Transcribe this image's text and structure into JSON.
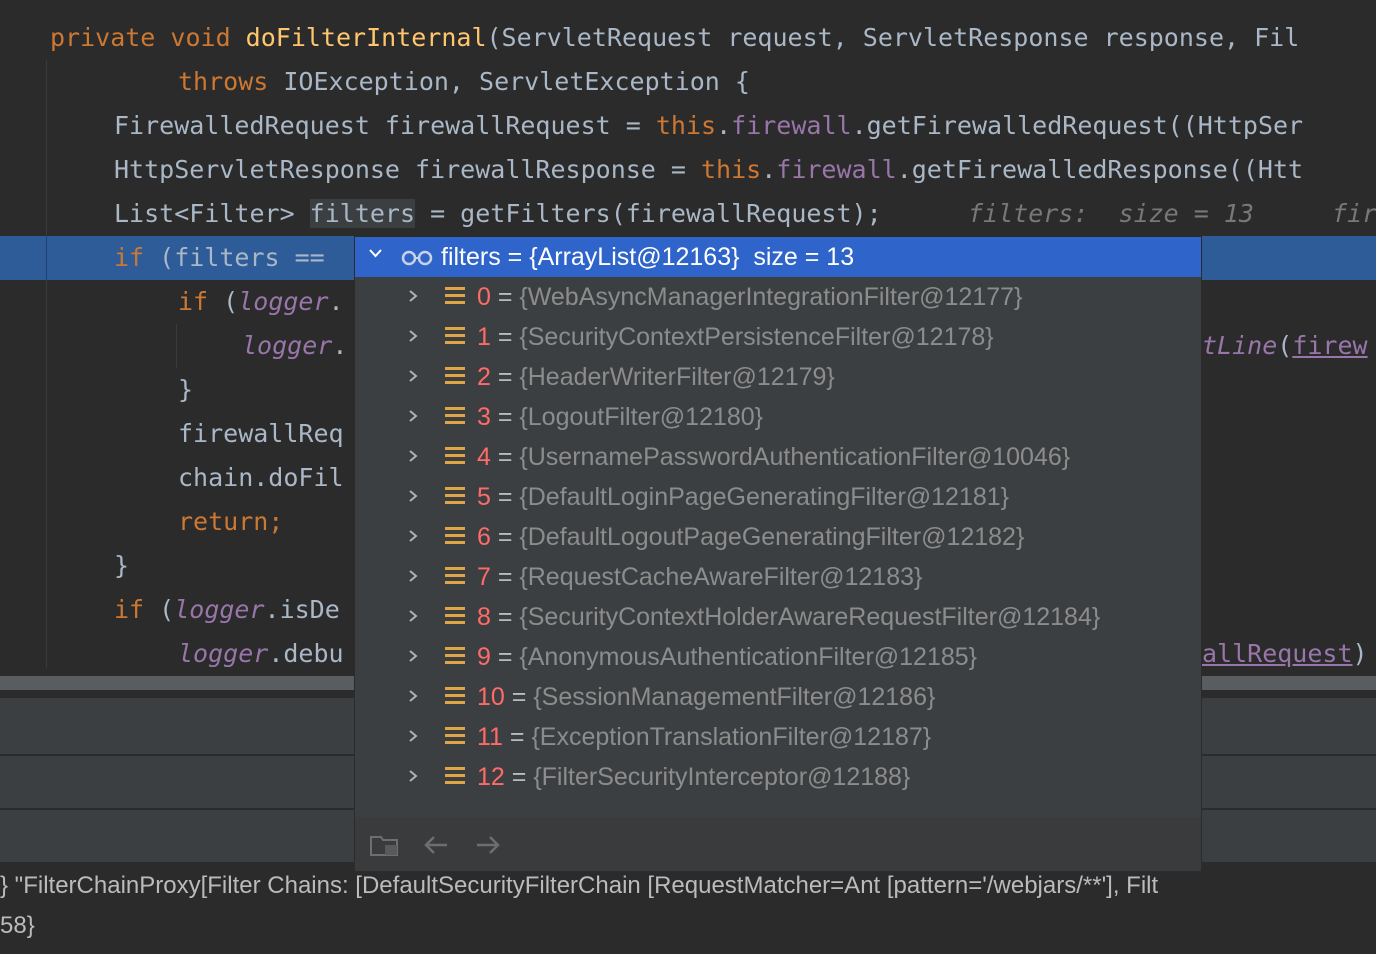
{
  "editor": {
    "line1": {
      "kw": "private void ",
      "fn": "doFilterInternal",
      "rest": "(ServletRequest request, ServletResponse response, Fil"
    },
    "line2": {
      "kw": "throws ",
      "rest": "IOException, ServletException {"
    },
    "line3": {
      "a": "FirewalledRequest firewallRequest = ",
      "kw": "this",
      "dot": ".",
      "field": "firewall",
      "rest": ".getFirewalledRequest((HttpSer"
    },
    "line4": {
      "a": "HttpServletResponse firewallResponse = ",
      "kw": "this",
      "dot": ".",
      "field": "firewall",
      "rest": ".getFirewalledResponse((Htt"
    },
    "line5": {
      "a": "List<Filter> ",
      "word": "filters",
      "b": " = getFilters(firewallRequest);",
      "semi": "",
      "hint1": "filters:  size = 13",
      "hint2": "fir"
    },
    "line6": {
      "kw": "if ",
      "rest": "(filters == "
    },
    "line7": {
      "kw": "if ",
      "a": "(",
      "it": "logger",
      "b": "."
    },
    "line8": {
      "it": "logger",
      "b": ".",
      "right_it": "tLine",
      "right_p": "(",
      "right_f": "firew"
    },
    "line9": {
      "text": "}"
    },
    "line10": {
      "text": "firewallReq"
    },
    "line11": {
      "text": "chain.doFil"
    },
    "line12": {
      "kw": "return;"
    },
    "line13": {
      "text": "}"
    },
    "line14": {
      "kw": "if ",
      "a": "(",
      "it": "logger",
      "b": ".isDe"
    },
    "line15": {
      "it": "logger",
      "b": ".debu",
      "right_f": "allRequest",
      "right_p": ")"
    }
  },
  "popup": {
    "header": "filters = {ArrayList@12163}  size = 13",
    "items": [
      {
        "index": "0",
        "value": "{WebAsyncManagerIntegrationFilter@12177}"
      },
      {
        "index": "1",
        "value": "{SecurityContextPersistenceFilter@12178}"
      },
      {
        "index": "2",
        "value": "{HeaderWriterFilter@12179}"
      },
      {
        "index": "3",
        "value": "{LogoutFilter@12180}"
      },
      {
        "index": "4",
        "value": "{UsernamePasswordAuthenticationFilter@10046}"
      },
      {
        "index": "5",
        "value": "{DefaultLoginPageGeneratingFilter@12181}"
      },
      {
        "index": "6",
        "value": "{DefaultLogoutPageGeneratingFilter@12182}"
      },
      {
        "index": "7",
        "value": "{RequestCacheAwareFilter@12183}"
      },
      {
        "index": "8",
        "value": "{SecurityContextHolderAwareRequestFilter@12184}"
      },
      {
        "index": "9",
        "value": "{AnonymousAuthenticationFilter@12185}"
      },
      {
        "index": "10",
        "value": "{SessionManagementFilter@12186}"
      },
      {
        "index": "11",
        "value": "{ExceptionTranslationFilter@12187}"
      },
      {
        "index": "12",
        "value": "{FilterSecurityInterceptor@12188}"
      }
    ],
    "footer_icons": [
      "open-in-tree-icon",
      "back-arrow-icon",
      "forward-arrow-icon"
    ]
  },
  "console": {
    "line1": "} \"FilterChainProxy[Filter Chains: [DefaultSecurityFilterChain [RequestMatcher=Ant [pattern='/webjars/**'], Filt",
    "line2": "58}"
  },
  "colors": {
    "keyword": "#cc7832",
    "method": "#ffc66d",
    "field": "#9876aa",
    "selection": "#2f65ca",
    "index": "#ff6b68"
  }
}
